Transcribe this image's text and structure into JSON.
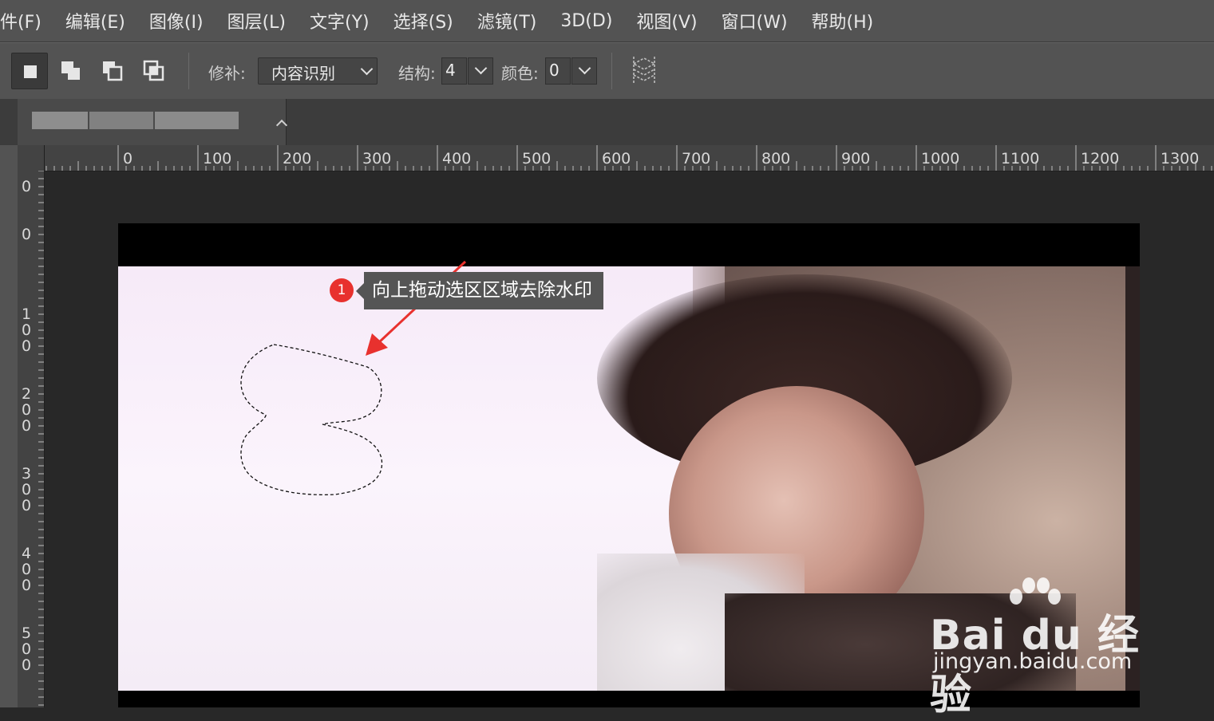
{
  "menubar": {
    "items": [
      "件(F)",
      "编辑(E)",
      "图像(I)",
      "图层(L)",
      "文字(Y)",
      "选择(S)",
      "滤镜(T)",
      "3D(D)",
      "视图(V)",
      "窗口(W)",
      "帮助(H)"
    ]
  },
  "options": {
    "patch_label": "修补:",
    "patch_value": "内容识别",
    "structure_label": "结构:",
    "structure_value": "4",
    "color_label": "颜色:",
    "color_value": "0"
  },
  "ruler_top": {
    "labels": [
      "0",
      "100",
      "200",
      "300",
      "400",
      "500",
      "600",
      "700",
      "800",
      "900",
      "1000",
      "1100",
      "1200",
      "1300"
    ]
  },
  "ruler_left": {
    "labels": [
      "0",
      "0",
      "1\n0\n0",
      "2\n0\n0",
      "3\n0\n0",
      "4\n0\n0",
      "5\n0\n0"
    ]
  },
  "callout": {
    "number": "1",
    "text": "向上拖动选区区域去除水印",
    "badge_color": "#e8312e",
    "arrow_color": "#e8312e"
  },
  "watermark": {
    "line1": "Bai du 经验",
    "line2": "jingyan.baidu.com"
  }
}
